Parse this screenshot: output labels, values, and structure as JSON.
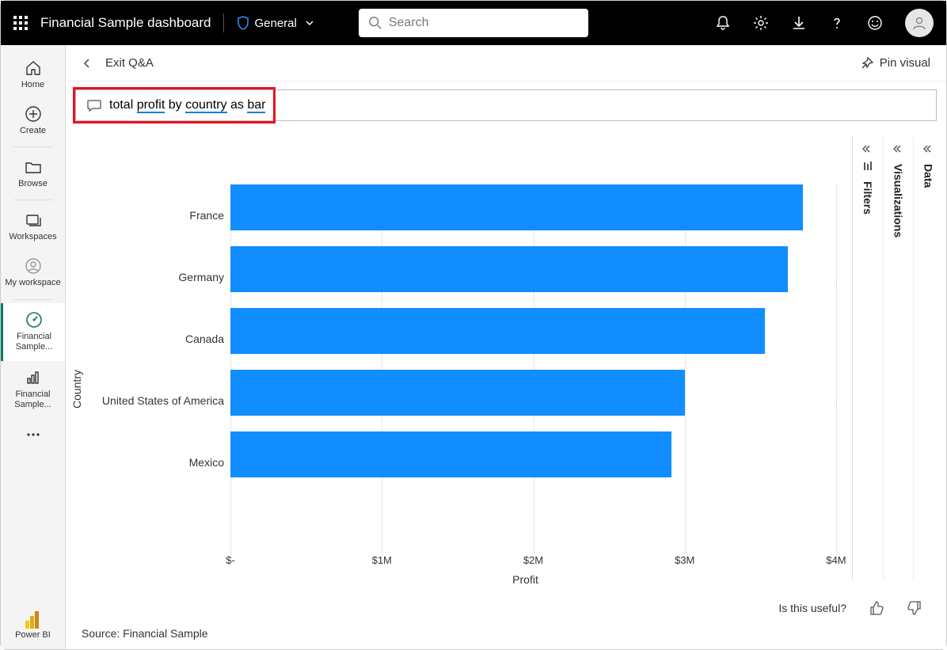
{
  "topbar": {
    "title": "Financial Sample dashboard",
    "sensitivity": "General",
    "search_placeholder": "Search"
  },
  "sidebar": {
    "items": [
      {
        "label": "Home"
      },
      {
        "label": "Create"
      },
      {
        "label": "Browse"
      },
      {
        "label": "Workspaces"
      },
      {
        "label": "My workspace"
      },
      {
        "label": "Financial Sample..."
      },
      {
        "label": "Financial Sample..."
      }
    ],
    "footer": "Power BI"
  },
  "header": {
    "exit_label": "Exit Q&A",
    "pin_label": "Pin visual"
  },
  "qna": {
    "prefix": "total ",
    "w1": "profit",
    "mid1": " by ",
    "w2": "country",
    "mid2": " as ",
    "w3": "bar"
  },
  "chart_data": {
    "type": "bar",
    "orientation": "horizontal",
    "ylabel": "Country",
    "xlabel": "Profit",
    "xlim": [
      0,
      4000000
    ],
    "x_ticks": [
      {
        "pos": 0.0,
        "label": "$-"
      },
      {
        "pos": 0.25,
        "label": "$1M"
      },
      {
        "pos": 0.5,
        "label": "$2M"
      },
      {
        "pos": 0.75,
        "label": "$3M"
      },
      {
        "pos": 1.0,
        "label": "$4M"
      }
    ],
    "categories": [
      "France",
      "Germany",
      "Canada",
      "United States of America",
      "Mexico"
    ],
    "values": [
      3780000,
      3680000,
      3530000,
      3000000,
      2910000
    ]
  },
  "feedback": {
    "question": "Is this useful?"
  },
  "source": {
    "text": "Source: Financial Sample"
  },
  "panes": {
    "filters": "Filters",
    "viz": "Visualizations",
    "data": "Data"
  }
}
